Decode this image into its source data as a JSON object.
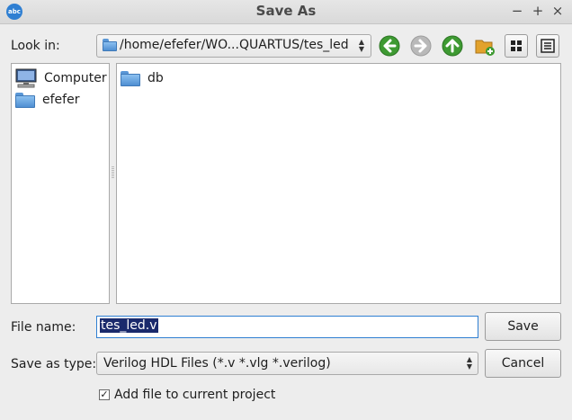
{
  "window": {
    "title": "Save As",
    "app_icon_text": "abc"
  },
  "controls": {
    "minimize": "−",
    "maximize": "+",
    "close": "×"
  },
  "look_in": {
    "label": "Look in:",
    "path": "/home/efefer/WO...QUARTUS/tes_led"
  },
  "toolbar": {
    "back_icon": "back-arrow",
    "forward_icon": "forward-arrow",
    "up_icon": "up-arrow",
    "new_folder_icon": "new-folder",
    "view_detail_icon": "detail-view",
    "view_list_icon": "list-view"
  },
  "sidebar": {
    "items": [
      {
        "label": "Computer",
        "icon": "computer-icon"
      },
      {
        "label": "efefer",
        "icon": "folder-icon"
      }
    ]
  },
  "files": {
    "items": [
      {
        "label": "db",
        "icon": "folder-icon"
      }
    ]
  },
  "file_name": {
    "label": "File name:",
    "value": "tes_led.v"
  },
  "file_type": {
    "label": "Save as type:",
    "value": "Verilog HDL Files (*.v *.vlg *.verilog)"
  },
  "buttons": {
    "save": "Save",
    "cancel": "Cancel"
  },
  "add_to_project": {
    "label": "Add file to current project",
    "checked": true,
    "mark": "✓"
  },
  "colors": {
    "accent": "#2f7fd2",
    "selection": "#1a2a6c",
    "nav_green": "#3e9a32"
  }
}
